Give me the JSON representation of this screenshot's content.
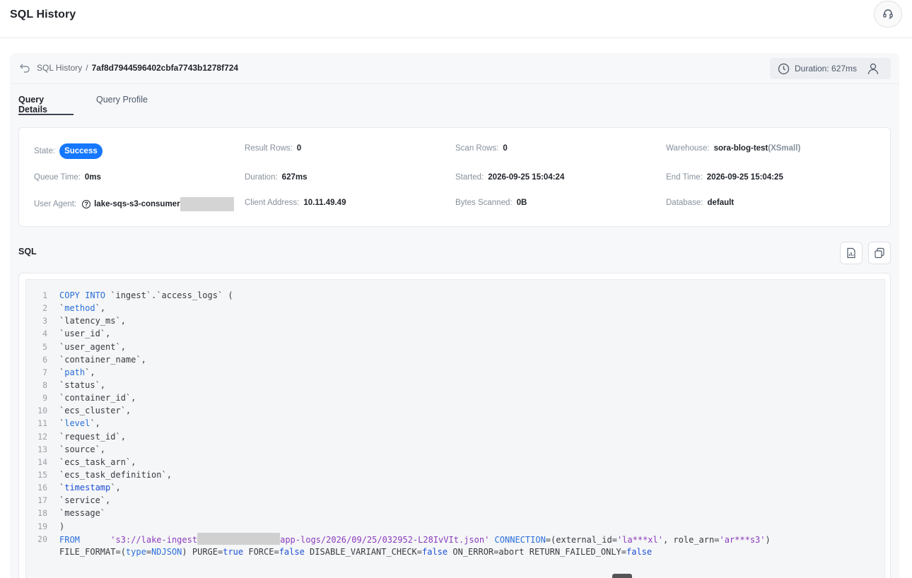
{
  "header": {
    "title": "SQL History"
  },
  "breadcrumb": {
    "parent": "SQL History",
    "separator": "/",
    "current": "7af8d7944596402cbfa7743b1278f724"
  },
  "duration_pill": {
    "text": "Duration: 627ms"
  },
  "tabs": [
    {
      "label": "Query Details",
      "active": true
    },
    {
      "label": "Query Profile",
      "active": false
    }
  ],
  "info": {
    "state": {
      "label": "State",
      "value": "Success"
    },
    "result_rows": {
      "label": "Result Rows",
      "value": "0"
    },
    "scan_rows": {
      "label": "Scan Rows",
      "value": "0"
    },
    "warehouse": {
      "label": "Warehouse",
      "value": "sora-blog-test",
      "size": "(XSmall)"
    },
    "queue_time": {
      "label": "Queue Time",
      "value": "0ms"
    },
    "duration": {
      "label": "Duration",
      "value": "627ms"
    },
    "started": {
      "label": "Started",
      "value": "2026-09-25 15:04:24"
    },
    "end_time": {
      "label": "End Time",
      "value": "2026-09-25 15:04:25"
    },
    "user_agent": {
      "label": "User Agent",
      "value": "lake-sqs-s3-consumer"
    },
    "client_address": {
      "label": "Client Address",
      "value": "10.11.49.49"
    },
    "bytes_scanned": {
      "label": "Bytes Scanned",
      "value": "0B"
    },
    "database": {
      "label": "Database",
      "value": "default"
    },
    "colon": ":"
  },
  "sql": {
    "title": "SQL",
    "lines": [
      {
        "n": "1",
        "parts": [
          [
            "kw",
            "COPY INTO"
          ],
          [
            "t",
            " `ingest`.`access_logs` ("
          ]
        ]
      },
      {
        "n": "2",
        "parts": [
          [
            "t",
            "`"
          ],
          [
            "kw",
            "method"
          ],
          [
            "t",
            "`,"
          ]
        ]
      },
      {
        "n": "3",
        "parts": [
          [
            "t",
            "`latency_ms`,"
          ]
        ]
      },
      {
        "n": "4",
        "parts": [
          [
            "t",
            "`user_id`,"
          ]
        ]
      },
      {
        "n": "5",
        "parts": [
          [
            "t",
            "`user_agent`,"
          ]
        ]
      },
      {
        "n": "6",
        "parts": [
          [
            "t",
            "`container_name`,"
          ]
        ]
      },
      {
        "n": "7",
        "parts": [
          [
            "t",
            "`"
          ],
          [
            "kw",
            "path"
          ],
          [
            "t",
            "`,"
          ]
        ]
      },
      {
        "n": "8",
        "parts": [
          [
            "t",
            "`status`,"
          ]
        ]
      },
      {
        "n": "9",
        "parts": [
          [
            "t",
            "`container_id`,"
          ]
        ]
      },
      {
        "n": "10",
        "parts": [
          [
            "t",
            "`ecs_cluster`,"
          ]
        ]
      },
      {
        "n": "11",
        "parts": [
          [
            "t",
            "`"
          ],
          [
            "kw",
            "level"
          ],
          [
            "t",
            "`,"
          ]
        ]
      },
      {
        "n": "12",
        "parts": [
          [
            "t",
            "`request_id`,"
          ]
        ]
      },
      {
        "n": "13",
        "parts": [
          [
            "t",
            "`source`,"
          ]
        ]
      },
      {
        "n": "14",
        "parts": [
          [
            "t",
            "`ecs_task_arn`,"
          ]
        ]
      },
      {
        "n": "15",
        "parts": [
          [
            "t",
            "`ecs_task_definition`,"
          ]
        ]
      },
      {
        "n": "16",
        "parts": [
          [
            "t",
            "`"
          ],
          [
            "bool",
            "timestamp"
          ],
          [
            "t",
            "`,"
          ]
        ]
      },
      {
        "n": "17",
        "parts": [
          [
            "t",
            "`service`,"
          ]
        ]
      },
      {
        "n": "18",
        "parts": [
          [
            "t",
            "`message`"
          ]
        ]
      },
      {
        "n": "19",
        "parts": [
          [
            "t",
            ")"
          ]
        ]
      },
      {
        "n": "20",
        "parts": [
          [
            "kw",
            "FROM"
          ],
          [
            "t",
            "      "
          ],
          [
            "str",
            "'s3://lake-ingest"
          ],
          [
            "redact",
            ""
          ],
          [
            "str",
            "app-logs/2026/09/25/032952-L28IvVIt.json'"
          ],
          [
            "t",
            " "
          ],
          [
            "kw",
            "CONNECTION"
          ],
          [
            "t",
            "=(external_id="
          ],
          [
            "str",
            "'la***xl'"
          ],
          [
            "t",
            ", role_arn="
          ],
          [
            "str",
            "'ar***s3'"
          ],
          [
            "t",
            ")"
          ]
        ]
      },
      {
        "n": "",
        "parts": [
          [
            "t",
            "FILE_FORMAT=("
          ],
          [
            "kw",
            "type"
          ],
          [
            "t",
            "="
          ],
          [
            "kw",
            "NDJSON"
          ],
          [
            "t",
            ") PURGE="
          ],
          [
            "bool",
            "true"
          ],
          [
            "t",
            " FORCE="
          ],
          [
            "bool",
            "false"
          ],
          [
            "t",
            " DISABLE_VARIANT_CHECK="
          ],
          [
            "bool",
            "false"
          ],
          [
            "t",
            " ON_ERROR=abort RETURN_FAILED_ONLY="
          ],
          [
            "bool",
            "false"
          ]
        ]
      }
    ]
  }
}
